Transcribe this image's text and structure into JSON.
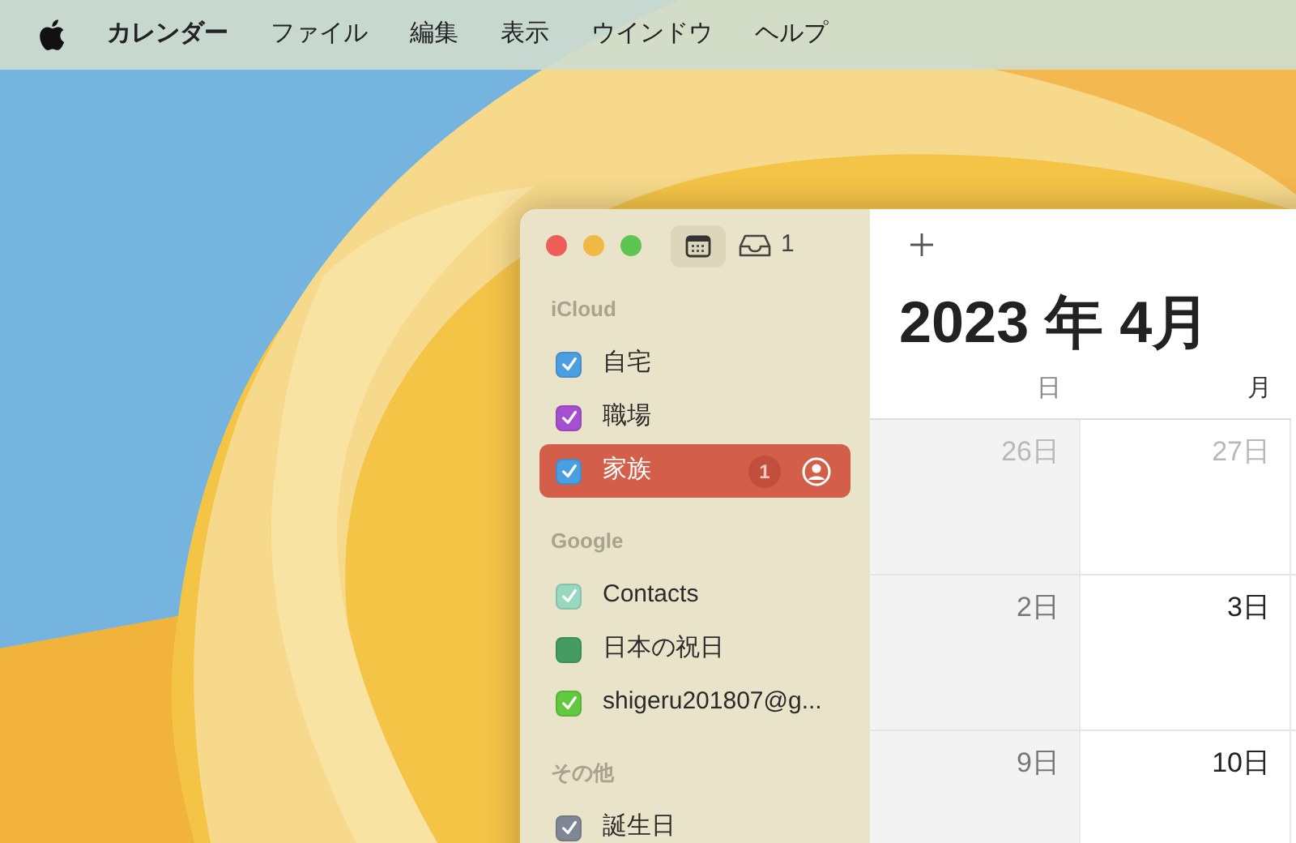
{
  "menu_bar": {
    "items": [
      {
        "label": "カレンダー",
        "bold": true
      },
      {
        "label": "ファイル",
        "bold": false
      },
      {
        "label": "編集",
        "bold": false
      },
      {
        "label": "表示",
        "bold": false
      },
      {
        "label": "ウインドウ",
        "bold": false
      },
      {
        "label": "ヘルプ",
        "bold": false
      }
    ]
  },
  "toolbar": {
    "inbox_count": "1",
    "calendar_view_selected": true
  },
  "sidebar": {
    "groups": [
      {
        "title": "iCloud",
        "calendars": [
          {
            "name": "自宅",
            "checked": true,
            "color": "#4a9fe0",
            "selected": false
          },
          {
            "name": "職場",
            "checked": true,
            "color": "#a64fd0",
            "selected": false
          },
          {
            "name": "家族",
            "checked": true,
            "color": "#4a9fe0",
            "selected": true,
            "badge": "1",
            "shared": true
          }
        ]
      },
      {
        "title": "Google",
        "calendars": [
          {
            "name": "Contacts",
            "checked": true,
            "color": "#98d8c0",
            "selected": false
          },
          {
            "name": "日本の祝日",
            "checked": false,
            "color": "#449c62",
            "selected": false
          },
          {
            "name": "shigeru201807@g...",
            "checked": true,
            "color": "#62c93f",
            "selected": false
          }
        ]
      },
      {
        "title": "その他",
        "calendars": [
          {
            "name": "誕生日",
            "checked": true,
            "color": "#7f8796",
            "selected": false
          }
        ]
      }
    ]
  },
  "calendar": {
    "title": "2023 年 4月",
    "weekdays": [
      "日",
      "月"
    ],
    "weeks": [
      [
        {
          "label": "26日",
          "in_month": false
        },
        {
          "label": "27日",
          "in_month": false
        }
      ],
      [
        {
          "label": "2日",
          "in_month": true
        },
        {
          "label": "3日",
          "in_month": true
        }
      ],
      [
        {
          "label": "9日",
          "in_month": true
        },
        {
          "label": "10日",
          "in_month": true
        }
      ]
    ]
  }
}
